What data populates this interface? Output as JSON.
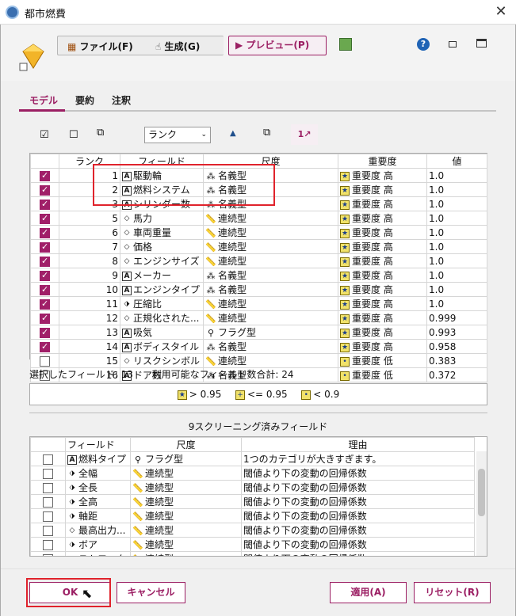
{
  "window": {
    "title": "都市燃費",
    "close": "✕"
  },
  "toolbar": {
    "file_label": "ファイル(F)",
    "generate_label": "生成(G)",
    "preview_label": "プレビュー(P)",
    "help": "?",
    "minimize": "▭",
    "maximize": "□"
  },
  "tabs": [
    "モデル",
    "要約",
    "注釈"
  ],
  "controls": {
    "sort_select": "ランク",
    "sort_options": [
      "ランク"
    ]
  },
  "main_table": {
    "headers": [
      "ランク",
      "フィールド",
      "尺度",
      "重要度",
      "値"
    ],
    "rows": [
      {
        "checked": true,
        "rank": "1",
        "type": "A",
        "field": "駆動輪",
        "measure": "名義型",
        "mi": "set",
        "importance": "重要度 高",
        "ii": "★",
        "value": "1.0"
      },
      {
        "checked": true,
        "rank": "2",
        "type": "A",
        "field": "燃料システム",
        "measure": "名義型",
        "mi": "set",
        "importance": "重要度 高",
        "ii": "★",
        "value": "1.0"
      },
      {
        "checked": true,
        "rank": "3",
        "type": "A",
        "field": "シリンダー数",
        "measure": "名義型",
        "mi": "set",
        "importance": "重要度 高",
        "ii": "★",
        "value": "1.0"
      },
      {
        "checked": true,
        "rank": "5",
        "type": "D",
        "field": "馬力",
        "measure": "連続型",
        "mi": "cont",
        "importance": "重要度 高",
        "ii": "★",
        "value": "1.0"
      },
      {
        "checked": true,
        "rank": "6",
        "type": "D",
        "field": "車両重量",
        "measure": "連続型",
        "mi": "cont",
        "importance": "重要度 高",
        "ii": "★",
        "value": "1.0"
      },
      {
        "checked": true,
        "rank": "7",
        "type": "D",
        "field": "価格",
        "measure": "連続型",
        "mi": "cont",
        "importance": "重要度 高",
        "ii": "★",
        "value": "1.0"
      },
      {
        "checked": true,
        "rank": "8",
        "type": "D",
        "field": "エンジンサイズ",
        "measure": "連続型",
        "mi": "cont",
        "importance": "重要度 高",
        "ii": "★",
        "value": "1.0"
      },
      {
        "checked": true,
        "rank": "9",
        "type": "A",
        "field": "メーカー",
        "measure": "名義型",
        "mi": "set",
        "importance": "重要度 高",
        "ii": "★",
        "value": "1.0"
      },
      {
        "checked": true,
        "rank": "10",
        "type": "A",
        "field": "エンジンタイプ",
        "measure": "名義型",
        "mi": "set",
        "importance": "重要度 高",
        "ii": "★",
        "value": "1.0"
      },
      {
        "checked": true,
        "rank": "11",
        "type": "D2",
        "field": "圧縮比",
        "measure": "連続型",
        "mi": "cont",
        "importance": "重要度 高",
        "ii": "★",
        "value": "1.0"
      },
      {
        "checked": true,
        "rank": "12",
        "type": "D",
        "field": "正規化された...",
        "measure": "連続型",
        "mi": "cont",
        "importance": "重要度 高",
        "ii": "★",
        "value": "0.999"
      },
      {
        "checked": true,
        "rank": "13",
        "type": "A",
        "field": "吸気",
        "measure": "フラグ型",
        "mi": "flag",
        "importance": "重要度 高",
        "ii": "★",
        "value": "0.993"
      },
      {
        "checked": true,
        "rank": "14",
        "type": "A",
        "field": "ボディスタイル",
        "measure": "名義型",
        "mi": "set",
        "importance": "重要度 高",
        "ii": "★",
        "value": "0.958"
      },
      {
        "checked": false,
        "rank": "15",
        "type": "D",
        "field": "リスクシンボル",
        "measure": "連続型",
        "mi": "cont",
        "importance": "重要度 低",
        "ii": "•",
        "value": "0.383"
      },
      {
        "checked": false,
        "rank": "16",
        "type": "A",
        "field": "ドア数",
        "measure": "名義型",
        "mi": "set",
        "importance": "重要度 低",
        "ii": "•",
        "value": "0.372"
      }
    ]
  },
  "status": {
    "selected_label": "選択したフィールド:",
    "selected_count": "13",
    "available_label": "利用可能なフィールド数合計:",
    "available_count": "24"
  },
  "legend": {
    "high": "> 0.95",
    "mid": "<= 0.95",
    "low": "< 0.9"
  },
  "screened": {
    "title": "9スクリーニング済みフィールド",
    "headers": [
      "フィールド",
      "尺度",
      "理由"
    ],
    "rows": [
      {
        "type": "A",
        "field": "燃料タイプ",
        "measure": "フラグ型",
        "mi": "flag",
        "reason": "1つのカテゴリが大きすぎます。"
      },
      {
        "type": "D2",
        "field": "全幅",
        "measure": "連続型",
        "mi": "cont",
        "reason": "閾値より下の変動の回帰係数"
      },
      {
        "type": "D2",
        "field": "全長",
        "measure": "連続型",
        "mi": "cont",
        "reason": "閾値より下の変動の回帰係数"
      },
      {
        "type": "D2",
        "field": "全高",
        "measure": "連続型",
        "mi": "cont",
        "reason": "閾値より下の変動の回帰係数"
      },
      {
        "type": "D2",
        "field": "軸距",
        "measure": "連続型",
        "mi": "cont",
        "reason": "閾値より下の変動の回帰係数"
      },
      {
        "type": "D",
        "field": "最高出力...",
        "measure": "連続型",
        "mi": "cont",
        "reason": "閾値より下の変動の回帰係数"
      },
      {
        "type": "D2",
        "field": "ボア",
        "measure": "連続型",
        "mi": "cont",
        "reason": "閾値より下の変動の回帰係数"
      },
      {
        "type": "D2",
        "field": "ストローク",
        "measure": "連続型",
        "mi": "cont",
        "reason": "閾値より下の変動の回帰係数"
      }
    ]
  },
  "footer": {
    "ok": "OK",
    "cancel": "キャンセル",
    "apply": "適用(A)",
    "reset": "リセット(R)"
  },
  "colors": {
    "accent": "#9b1e63",
    "highlight": "#e0232c"
  }
}
